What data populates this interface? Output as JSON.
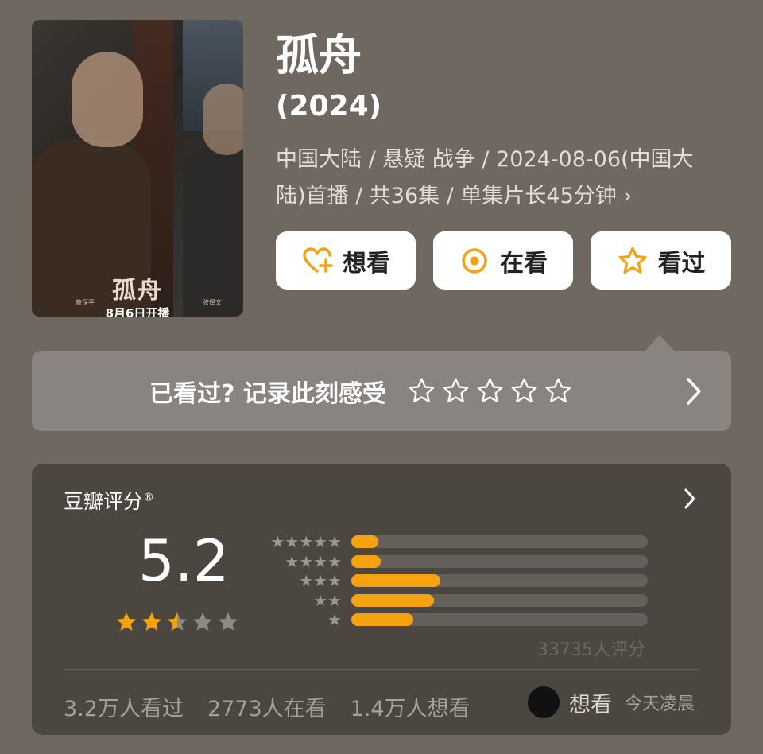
{
  "poster": {
    "title_art": "孤舟",
    "credit_left": "曹保平",
    "credit_right": "张译文",
    "release_text": "8月6日开播"
  },
  "show": {
    "title": "孤舟",
    "year": "(2024)",
    "meta": "中国大陆 / 悬疑 战争 / 2024-08-06(中国大陆)首播 / 共36集 / 单集片长45分钟 ›"
  },
  "actions": {
    "want": "想看",
    "watching": "在看",
    "watched": "看过"
  },
  "rate_prompt": {
    "text": "已看过? 记录此刻感受",
    "arrow": "›"
  },
  "rating_card": {
    "label": "豆瓣评分",
    "registered_mark": "®",
    "arrow": "›",
    "score": "5.2",
    "score_stars": 2.5,
    "distribution": [
      {
        "stars": 5,
        "percent": 9
      },
      {
        "stars": 4,
        "percent": 10
      },
      {
        "stars": 3,
        "percent": 30
      },
      {
        "stars": 2,
        "percent": 28
      },
      {
        "stars": 1,
        "percent": 21
      }
    ],
    "rating_count": "33735人评分",
    "stats": {
      "watched": "3.2万人看过",
      "watching": "2773人在看",
      "want": "1.4万人想看"
    },
    "friend_activity": {
      "action": "想看",
      "time": "今天凌晨"
    }
  },
  "colors": {
    "background": "#6f6860",
    "accent": "#f4a20f",
    "card": "#4c4640"
  }
}
